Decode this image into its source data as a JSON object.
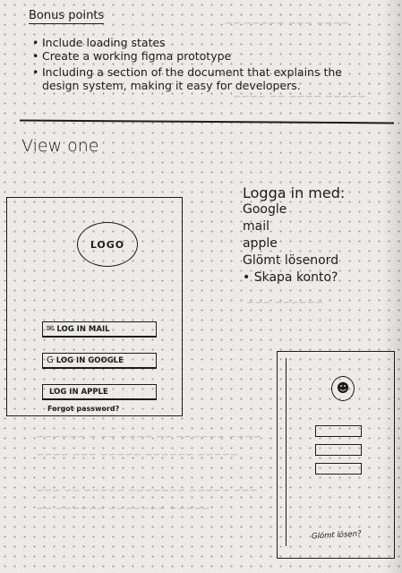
{
  "section": {
    "heading": "Bonus points",
    "bullets": [
      "Include loading states",
      "Create a working figma prototype",
      "Including a section of the document that explains the design system, making it easy for developers."
    ]
  },
  "view": {
    "title": "View one"
  },
  "phone_one": {
    "logo": "LOGO",
    "buttons": [
      {
        "icon": "mail-icon",
        "label": "Log in Mail"
      },
      {
        "icon": "google-icon",
        "label": "Log in Google"
      },
      {
        "icon": "apple-icon",
        "label": "Log in Apple"
      }
    ],
    "forgot": "Forgot password?"
  },
  "side_list": {
    "title": "Logga in med:",
    "items": [
      "Google",
      "mail",
      "apple",
      "Glömt lösenord"
    ],
    "bullet_item": "• Skapa konto?"
  },
  "phone_two": {
    "forgot": "Glömt lösen?"
  }
}
